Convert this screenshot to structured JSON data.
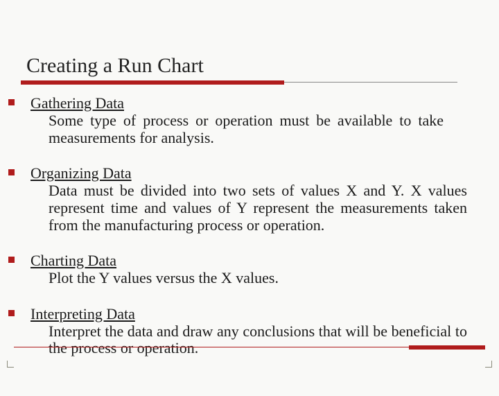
{
  "title": "Creating a Run Chart",
  "items": [
    {
      "heading": "Gathering Data",
      "body": "Some type of process or operation must be available to take measurements for analysis."
    },
    {
      "heading": "Organizing Data",
      "body": "Data must be divided into two sets of values X and Y. X values represent time and values of Y represent the measurements taken from the manufacturing process or operation."
    },
    {
      "heading": "Charting Data",
      "body": "Plot the Y values versus the X values."
    },
    {
      "heading": "Interpreting Data",
      "body": "Interpret the data and draw any conclusions that will be beneficial to the process or operation."
    }
  ]
}
